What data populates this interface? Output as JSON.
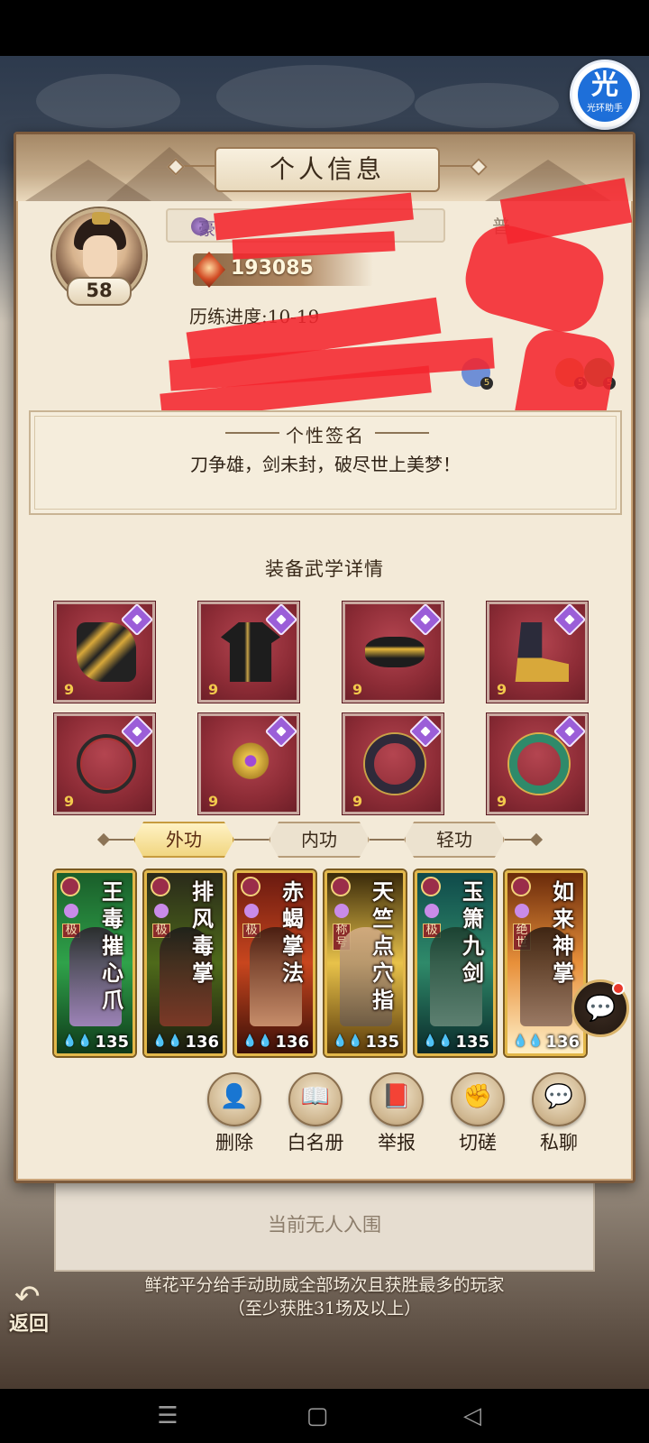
{
  "assistant": {
    "glyph": "光",
    "label": "光环助手"
  },
  "dialog": {
    "title": "个人信息",
    "profile": {
      "level": "58",
      "name_fragment": "豪",
      "power": "193085",
      "progress": "历练进度:10-19",
      "side_label": "普"
    },
    "stat_icons": [
      {
        "name": "skill-icon-a",
        "level": "5",
        "color": "#6f8fd6"
      },
      {
        "name": "skill-icon-b",
        "level": "5",
        "color": "#c99a3c"
      },
      {
        "name": "skill-icon-c",
        "level": "5",
        "color": "#3da23a"
      }
    ],
    "signature": {
      "title": "个性签名",
      "text": "刀争雄，剑未封，破尽世上美梦！"
    },
    "equipment_title": "装备武学详情",
    "equipment": [
      {
        "icon": "gauntlet-icon",
        "level": "9"
      },
      {
        "icon": "robe-icon",
        "level": "9"
      },
      {
        "icon": "belt-icon",
        "level": "9"
      },
      {
        "icon": "boots-icon",
        "level": "9"
      },
      {
        "icon": "necklace-icon",
        "level": "9"
      },
      {
        "icon": "hairpin-icon",
        "level": "9"
      },
      {
        "icon": "bracer-icon",
        "level": "9"
      },
      {
        "icon": "ring-icon",
        "level": "9"
      }
    ],
    "tabs": [
      {
        "label": "外功",
        "active": true
      },
      {
        "label": "内功",
        "active": false
      },
      {
        "label": "轻功",
        "active": false
      }
    ],
    "skills": [
      {
        "name": "王毒摧心爪",
        "tag": "极",
        "level": "135",
        "bg": "#1c7a3a"
      },
      {
        "name": "排风毒掌",
        "tag": "极",
        "level": "136",
        "bg": "#24301a"
      },
      {
        "name": "赤蝎掌法",
        "tag": "极",
        "level": "136",
        "bg": "#8a2a18"
      },
      {
        "name": "天竺点穴指",
        "tag": "称号",
        "level": "135",
        "bg": "#c8961e"
      },
      {
        "name": "玉箫九剑",
        "tag": "极",
        "level": "135",
        "bg": "#1e6a6a"
      },
      {
        "name": "如来神掌",
        "tag": "绝世",
        "level": "136",
        "bg": "#c06a1e"
      }
    ],
    "actions": [
      {
        "name": "delete-button",
        "icon": "trash-icon",
        "glyph": "👤",
        "label": "删除"
      },
      {
        "name": "whitelist-button",
        "icon": "book-icon",
        "glyph": "📖",
        "label": "白名册"
      },
      {
        "name": "report-button",
        "icon": "blacklist-book-icon",
        "glyph": "📕",
        "label": "举报"
      },
      {
        "name": "spar-button",
        "icon": "fist-icon",
        "glyph": "✊",
        "label": "切磋"
      },
      {
        "name": "private-chat-button",
        "icon": "chat-bubble-icon",
        "glyph": "💬",
        "label": "私聊"
      }
    ]
  },
  "background": {
    "board_text": "当前无人入围",
    "notice": "鲜花平分给手动助威全部场次且获胜最多的玩家（至少获胜31场及以上）",
    "back_label": "返回"
  },
  "nav": {
    "menu": "☰",
    "home": "▢",
    "back": "◁"
  }
}
